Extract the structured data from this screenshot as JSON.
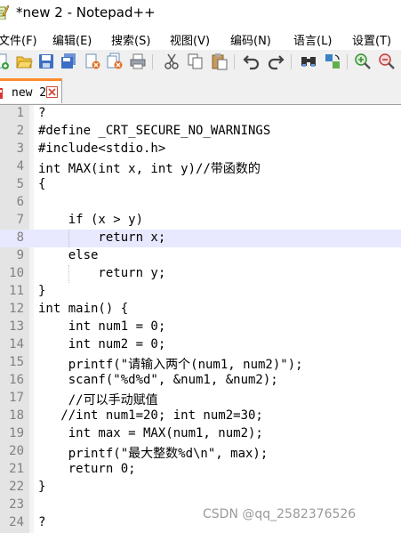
{
  "window": {
    "title": "*new 2 - Notepad++"
  },
  "menu": [
    {
      "key": "file",
      "label": "文件(F)"
    },
    {
      "key": "edit",
      "label": "编辑(E)"
    },
    {
      "key": "search",
      "label": "搜索(S)"
    },
    {
      "key": "view",
      "label": "视图(V)"
    },
    {
      "key": "encoding",
      "label": "编码(N)"
    },
    {
      "key": "language",
      "label": "语言(L)"
    },
    {
      "key": "settings",
      "label": "设置(T)"
    }
  ],
  "toolbar": {
    "icons": [
      "new-file-icon",
      "open-folder-icon",
      "save-icon",
      "save-all-icon",
      "close-icon",
      "close-all-icon",
      "print-icon",
      "cut-icon",
      "copy-icon",
      "paste-icon",
      "undo-icon",
      "redo-icon",
      "find-icon",
      "replace-icon",
      "zoom-in-icon",
      "zoom-out-icon"
    ]
  },
  "tabs": [
    {
      "label": "new 2",
      "modified": true
    }
  ],
  "editor": {
    "current_line": 8,
    "lines": [
      {
        "n": "1",
        "text": "?"
      },
      {
        "n": "2",
        "text": "#define _CRT_SECURE_NO_WARNINGS"
      },
      {
        "n": "3",
        "text": "#include<stdio.h>"
      },
      {
        "n": "4",
        "text": "int MAX(int x, int y)//带函数的"
      },
      {
        "n": "5",
        "text": "{"
      },
      {
        "n": "6",
        "text": ""
      },
      {
        "n": "7",
        "text": "    if (x > y)"
      },
      {
        "n": "8",
        "text": "        return x;"
      },
      {
        "n": "9",
        "text": "    else"
      },
      {
        "n": "10",
        "text": "        return y;"
      },
      {
        "n": "11",
        "text": "}"
      },
      {
        "n": "12",
        "text": "int main() {"
      },
      {
        "n": "13",
        "text": "    int num1 = 0;"
      },
      {
        "n": "14",
        "text": "    int num2 = 0;"
      },
      {
        "n": "15",
        "text": "    printf(\"请输入两个(num1, num2)\");"
      },
      {
        "n": "16",
        "text": "    scanf(\"%d%d\", &num1, &num2);"
      },
      {
        "n": "17",
        "text": "    //可以手动赋值"
      },
      {
        "n": "18",
        "text": "   //int num1=20; int num2=30;"
      },
      {
        "n": "19",
        "text": "    int max = MAX(num1, num2);"
      },
      {
        "n": "20",
        "text": "    printf(\"最大整数%d\\n\", max);"
      },
      {
        "n": "21",
        "text": "    return 0;"
      },
      {
        "n": "22",
        "text": "}"
      },
      {
        "n": "23",
        "text": ""
      },
      {
        "n": "24",
        "text": "?"
      }
    ]
  },
  "watermark": "CSDN @qq_2582376526",
  "colors": {
    "current_line": "#e8e8ff",
    "tab_accent": "#ff8c2e",
    "line_number": "#808080",
    "gutter": "#e4e4e4"
  }
}
